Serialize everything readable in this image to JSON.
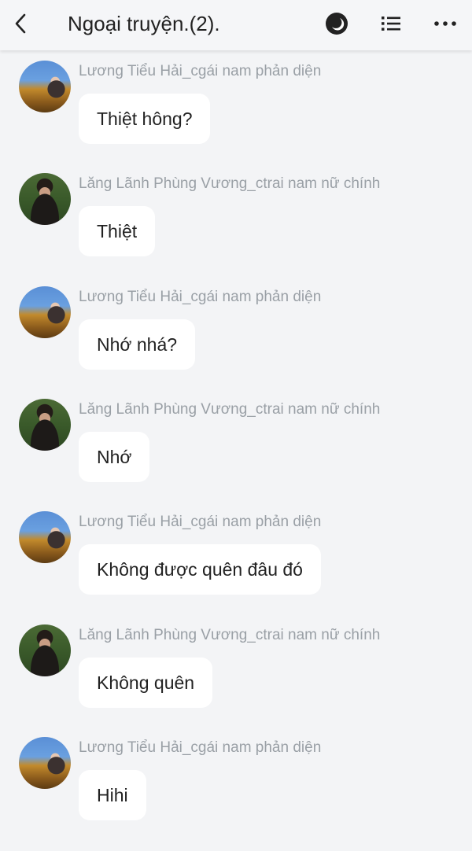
{
  "header": {
    "title": "Ngoại truyện.(2).",
    "icons": [
      "back-icon",
      "night-mode-icon",
      "list-icon",
      "more-icon"
    ]
  },
  "messages": [
    {
      "sender": "Lương Tiểu Hải_cgái nam phản diện",
      "text": "Thiệt hông?"
    },
    {
      "sender": "Lăng Lãnh Phùng Vương_ctrai nam nữ chính",
      "text": "Thiệt"
    },
    {
      "sender": "Lương Tiểu Hải_cgái nam phản diện",
      "text": "Nhớ nhá?"
    },
    {
      "sender": "Lăng Lãnh Phùng Vương_ctrai nam nữ chính",
      "text": "Nhớ"
    },
    {
      "sender": "Lương Tiểu Hải_cgái nam phản diện",
      "text": "Không được quên đâu đó"
    },
    {
      "sender": "Lăng Lãnh Phùng Vương_ctrai nam nữ chính",
      "text": "Không quên"
    },
    {
      "sender": "Lương Tiểu Hải_cgái nam phản diện",
      "text": "Hihi"
    }
  ]
}
